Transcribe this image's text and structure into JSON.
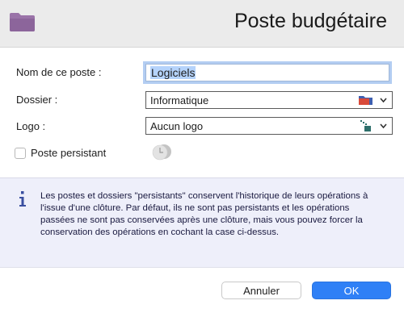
{
  "header": {
    "title": "Poste budgétaire",
    "icon": "folder-icon",
    "icon_color": "#9a73a8"
  },
  "form": {
    "name_label": "Nom de ce poste :",
    "name_value": "Logiciels",
    "folder_label": "Dossier :",
    "folder_value": "Informatique",
    "folder_icon": "folder-icon",
    "logo_label": "Logo :",
    "logo_value": "Aucun logo",
    "logo_icon": "no-logo-icon",
    "persistent_label": "Poste persistant",
    "persistent_checked": false,
    "persistent_icon": "clock-icon"
  },
  "info": {
    "icon": "info-icon",
    "text": "Les postes et dossiers \"persistants\" conservent l'historique de leurs opérations à l'issue d'une clôture. Par défaut, ils ne sont pas persistants et les opérations passées ne sont pas conservées après une clôture, mais vous pouvez forcer la conservation des opérations en cochant la case ci-dessus."
  },
  "buttons": {
    "cancel": "Annuler",
    "ok": "OK"
  },
  "colors": {
    "accent": "#2f80f6",
    "info_bg": "#eeeffa",
    "header_bg": "#ebebeb"
  }
}
